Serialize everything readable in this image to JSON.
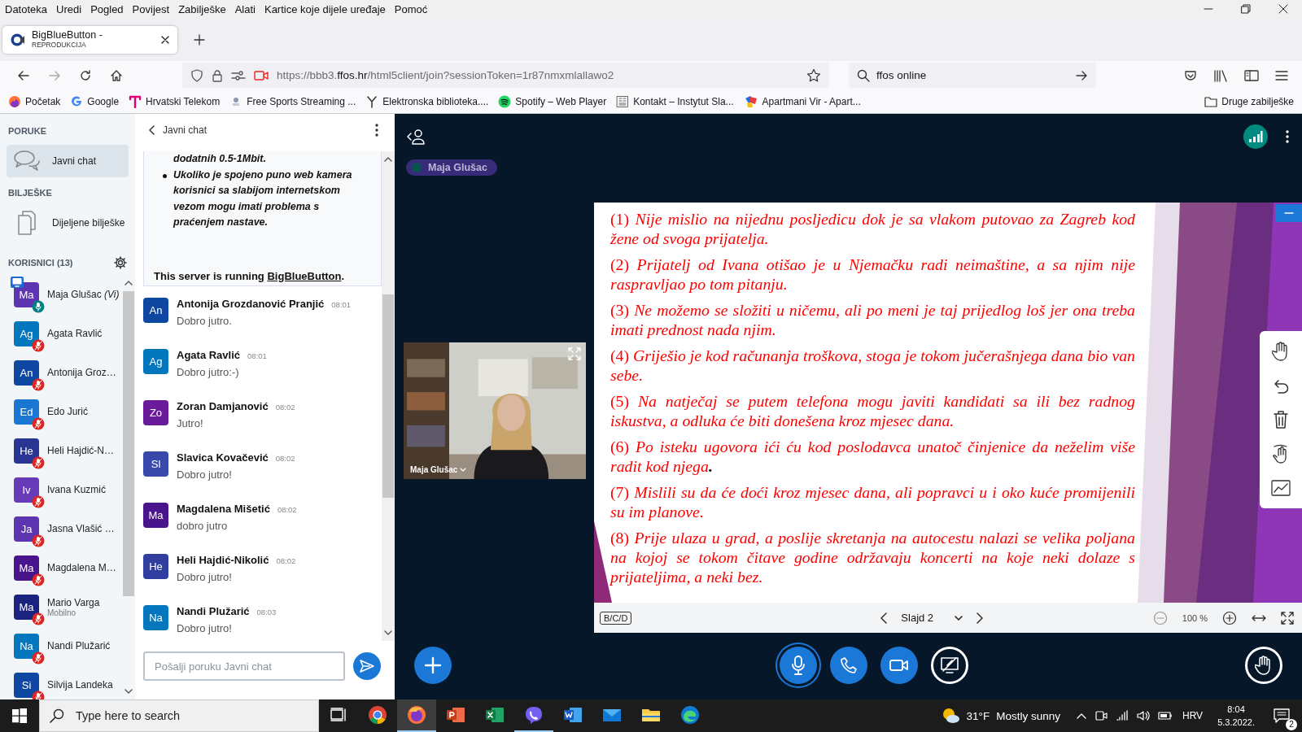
{
  "menu_bar": [
    "Datoteka",
    "Uredi",
    "Pogled",
    "Povijest",
    "Zabilješke",
    "Alati",
    "Kartice koje dijele uređaje",
    "Pomoć"
  ],
  "browser_tab": {
    "title": "BigBlueButton -",
    "subtitle": "REPRODUKCIJA",
    "selected": true
  },
  "address_bar": {
    "url": "https://bbb3.**ffos.hr**/html5client/join?sessionToken=1r87nmxmlallawo2"
  },
  "search_bar": {
    "value": "ffos online"
  },
  "bookmarks": [
    {
      "label": "Početak",
      "kind": "firefox"
    },
    {
      "label": "Google",
      "kind": "google"
    },
    {
      "label": "Hrvatski Telekom",
      "kind": "telekom"
    },
    {
      "label": "Free Sports Streaming ...",
      "kind": "sports"
    },
    {
      "label": "Elektronska biblioteka....",
      "kind": "library"
    },
    {
      "label": "Spotify – Web Player",
      "kind": "spotify"
    },
    {
      "label": "Kontakt – Instytut Sla...",
      "kind": "page"
    },
    {
      "label": "Apartmani Vir - Apart...",
      "kind": "apartments"
    }
  ],
  "other_bookmarks": "Druge zabilješke",
  "sidebar": {
    "messages_heading": "PORUKE",
    "chats": [
      {
        "label": "Javni chat",
        "selected": true
      }
    ],
    "notes_heading": "BILJEŠKE",
    "notes": [
      {
        "label": "Dijeljene bilješke"
      }
    ],
    "users_heading": "KORISNICI (13)",
    "users": [
      {
        "initials": "Ma",
        "name": "Maja Glušac *(Vi)*",
        "color": "#5e35b1",
        "muted": false,
        "presenter": true
      },
      {
        "initials": "Ag",
        "name": "Agata Ravlić",
        "color": "#0277bd",
        "muted": true,
        "presenter": false
      },
      {
        "initials": "An",
        "name": "Antonija Groz…",
        "color": "#0d47a1",
        "muted": true,
        "presenter": false
      },
      {
        "initials": "Ed",
        "name": "Edo Jurić",
        "color": "#1976d2",
        "muted": true,
        "presenter": false
      },
      {
        "initials": "He",
        "name": "Heli Hajdić-N…",
        "color": "#283593",
        "muted": true,
        "presenter": false
      },
      {
        "initials": "Iv",
        "name": "Ivana Kuzmić",
        "color": "#673ab7",
        "muted": true,
        "presenter": false
      },
      {
        "initials": "Ja",
        "name": "Jasna Vlašić …",
        "color": "#5e35b1",
        "muted": true,
        "presenter": false
      },
      {
        "initials": "Ma",
        "name": "Magdalena M…",
        "color": "#4a148c",
        "muted": true,
        "presenter": false
      },
      {
        "initials": "Ma",
        "name": "Mario Varga",
        "subtitle": "Mobilno",
        "color": "#1a237e",
        "muted": true,
        "presenter": false
      },
      {
        "initials": "Na",
        "name": "Nandi Plužarić",
        "color": "#0277bd",
        "muted": true,
        "presenter": false
      },
      {
        "initials": "Si",
        "name": "Silvija Landeka",
        "color": "#0d47a1",
        "muted": true,
        "presenter": false
      }
    ]
  },
  "chat": {
    "title": "Javni chat",
    "welcome": {
      "bullets": [
        {
          "text": "dodatnih 0.5-1Mbit.",
          "marker": false
        },
        {
          "text": "Ukoliko je spojeno puno web kamera korisnici sa slabijom internetskom vezom mogu imati problema s praćenjem nastave.",
          "marker": true
        }
      ],
      "server_prefix": "This server is running ",
      "server_link": "BigBlueButton",
      "server_suffix": "."
    },
    "messages": [
      {
        "initials": "An",
        "name": "Antonija Grozdanović Pranjić",
        "time": "08:01",
        "text": "Dobro jutro.",
        "color": "#0d47a1"
      },
      {
        "initials": "Ag",
        "name": "Agata Ravlić",
        "time": "08:01",
        "text": "Dobro jutro:-)",
        "color": "#0277bd"
      },
      {
        "initials": "Zo",
        "name": "Zoran Damjanović",
        "time": "08:02",
        "text": "Jutro!",
        "color": "#6a1b9a"
      },
      {
        "initials": "Sl",
        "name": "Slavica Kovačević",
        "time": "08:02",
        "text": "Dobro jutro!",
        "color": "#3949ab"
      },
      {
        "initials": "Ma",
        "name": "Magdalena Mišetić",
        "time": "08:02",
        "text": "dobro jutro",
        "color": "#4a148c"
      },
      {
        "initials": "He",
        "name": "Heli Hajdić-Nikolić",
        "time": "08:02",
        "text": "Dobro jutro!",
        "color": "#303f9f"
      },
      {
        "initials": "Na",
        "name": "Nandi Plužarić",
        "time": "08:03",
        "text": "Dobro jutro!",
        "color": "#0277bd"
      }
    ],
    "input": {
      "placeholder": "Pošalji poruku Javni chat"
    }
  },
  "presentation": {
    "talker": {
      "name": "Maja Glušac",
      "talking": true
    },
    "video": {
      "name": "Maja Glušac"
    },
    "slide": {
      "items": [
        {
          "number": "(1)",
          "text": "Nije mislio na nijednu posljedicu dok je sa vlakom putovao za Zagreb kod žene od svoga prijatelja."
        },
        {
          "number": "(2)",
          "text": "Prijatelj od Ivana otišao je u Njemačku radi neimaštine, a sa njim nije raspravljao po tom pitanju."
        },
        {
          "number": "(3)",
          "text": "Ne možemo se složiti u ničemu, ali po meni je taj prijedlog loš jer ona treba imati prednost nada njim."
        },
        {
          "number": "(4)",
          "text": "Griješio je kod računanja troškova, stoga je tokom jučerašnjega dana bio van sebe."
        },
        {
          "number": "(5)",
          "text": "Na natječaj se putem telefona mogu javiti kandidati sa ili bez radnog iskustva, a odluka će biti donešena kroz mjesec dana."
        },
        {
          "number": "(6)",
          "text": "Po isteku ugovora ići ću kod poslodavca unatoč činjenice da neželim više radit kod njega**.**"
        },
        {
          "number": "(7)",
          "text": "Mislili su da će doći kroz mjesec dana, ali popravci u i oko kuće promijenili su im planove."
        },
        {
          "number": "(8)",
          "text": "Prije ulaza u grad, a poslije skretanja na autocestu nalazi se velika poljana na kojoj se tokom čitave godine održavaju koncerti na koje neki dolaze s prijateljima, a neki bez."
        }
      ]
    },
    "toolbar": {
      "layout_button": "B/C/D",
      "slide_label": "Slajd 2",
      "zoom": "100 %"
    },
    "mic_active": true
  },
  "taskbar": {
    "search_placeholder": "Type here to search",
    "apps": [
      {
        "kind": "task-view",
        "selected": false,
        "running": false
      },
      {
        "kind": "chrome",
        "selected": false,
        "running": false
      },
      {
        "kind": "firefox",
        "selected": true,
        "running": true
      },
      {
        "kind": "powerpoint",
        "selected": false,
        "running": false
      },
      {
        "kind": "excel",
        "selected": false,
        "running": false
      },
      {
        "kind": "viber",
        "selected": false,
        "running": true
      },
      {
        "kind": "word",
        "selected": false,
        "running": false
      },
      {
        "kind": "mail",
        "selected": false,
        "running": false
      },
      {
        "kind": "explorer",
        "selected": false,
        "running": false
      },
      {
        "kind": "edge",
        "selected": false,
        "running": false
      }
    ],
    "temperature": "31°F",
    "weather": "Mostly sunny",
    "language": "HRV",
    "time": "8:04",
    "date": "5.3.2022.",
    "notifications": "2"
  }
}
